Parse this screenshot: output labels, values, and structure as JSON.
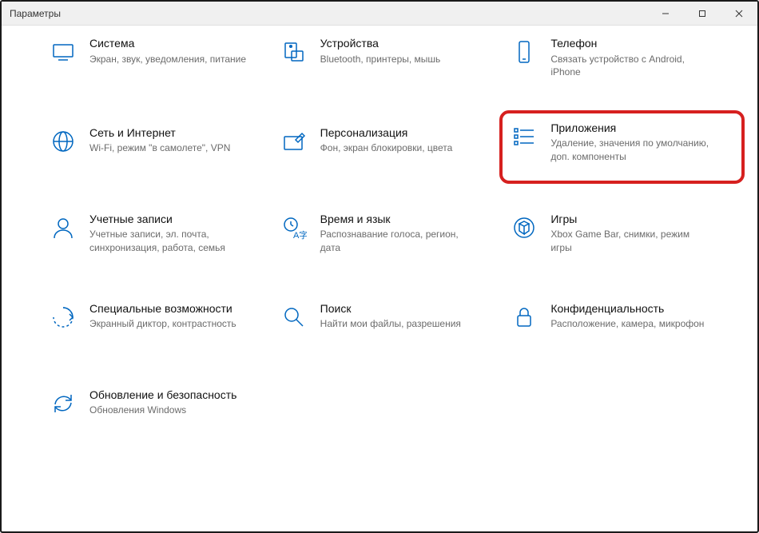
{
  "window": {
    "title": "Параметры"
  },
  "tiles": [
    {
      "title": "Система",
      "desc": "Экран, звук, уведомления, питание"
    },
    {
      "title": "Устройства",
      "desc": "Bluetooth, принтеры, мышь"
    },
    {
      "title": "Телефон",
      "desc": "Связать устройство с Android, iPhone"
    },
    {
      "title": "Сеть и Интернет",
      "desc": "Wi-Fi, режим \"в самолете\", VPN"
    },
    {
      "title": "Персонализация",
      "desc": "Фон, экран блокировки, цвета"
    },
    {
      "title": "Приложения",
      "desc": "Удаление, значения по умолчанию, доп. компоненты"
    },
    {
      "title": "Учетные записи",
      "desc": "Учетные записи, эл. почта, синхронизация, работа, семья"
    },
    {
      "title": "Время и язык",
      "desc": "Распознавание голоса, регион, дата"
    },
    {
      "title": "Игры",
      "desc": "Xbox Game Bar, снимки, режим игры"
    },
    {
      "title": "Специальные возможности",
      "desc": "Экранный диктор, контрастность"
    },
    {
      "title": "Поиск",
      "desc": "Найти мои файлы, разрешения"
    },
    {
      "title": "Конфиденциальность",
      "desc": "Расположение, камера, микрофон"
    },
    {
      "title": "Обновление и безопасность",
      "desc": "Обновления Windows"
    }
  ],
  "highlighted_index": 5
}
